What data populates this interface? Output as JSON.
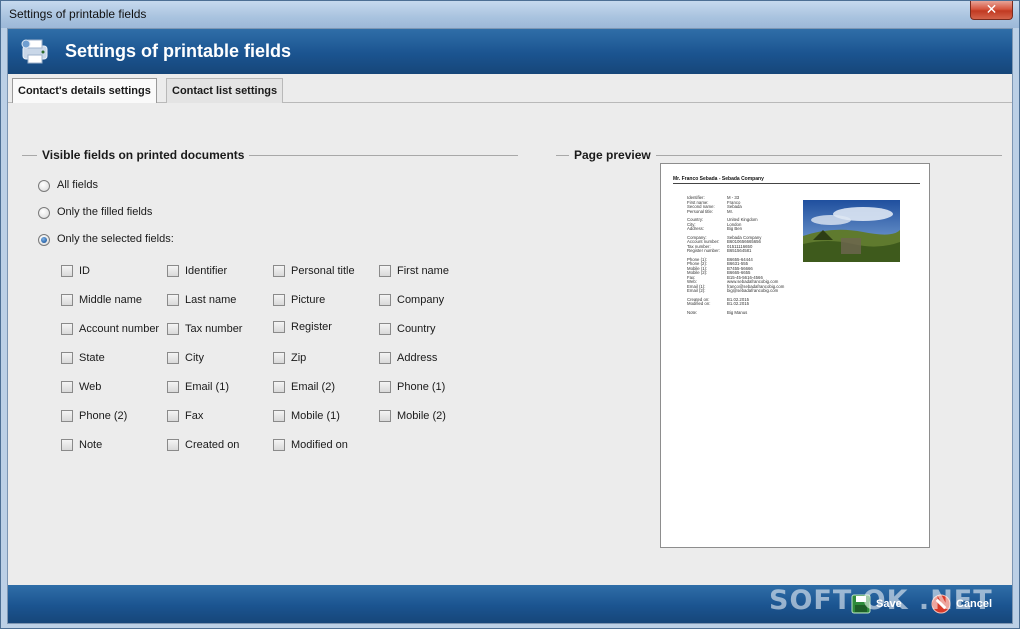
{
  "window": {
    "title": "Settings of printable fields"
  },
  "header": {
    "title": "Settings of printable fields",
    "icon": "settings-printer-icon"
  },
  "tabs": [
    {
      "label": "Contact's details settings",
      "active": true
    },
    {
      "label": "Contact list settings",
      "active": false
    }
  ],
  "visible_fields": {
    "title": "Visible fields on printed documents",
    "options": [
      {
        "label": "All fields",
        "checked": false
      },
      {
        "label": "Only the filled fields",
        "checked": false
      },
      {
        "label": "Only the selected fields:",
        "checked": true
      }
    ],
    "fields": [
      [
        "ID",
        "Identifier",
        "Personal title",
        "First name"
      ],
      [
        "Middle name",
        "Last name",
        "Picture",
        "Company"
      ],
      [
        "Account number",
        "Tax number",
        "Register",
        "Country"
      ],
      [
        "State",
        "City",
        "Zip",
        "Address"
      ],
      [
        "Web",
        "Email (1)",
        "Email (2)",
        "Phone (1)"
      ],
      [
        "Phone (2)",
        "Fax",
        "Mobile (1)",
        "Mobile (2)"
      ],
      [
        "Note",
        "Created on",
        "Modified on"
      ]
    ]
  },
  "preview": {
    "title": "Page preview",
    "heading": "Mr. Franco Sebada - Sebada Company",
    "lines": [
      [
        "Identifier:",
        "M - 33"
      ],
      [
        "First name:",
        "Franco"
      ],
      [
        "Second name:",
        "Sebada"
      ],
      [
        "Personal title:",
        "Mr."
      ],
      [
        "",
        ""
      ],
      [
        "Country:",
        "United Kingdom"
      ],
      [
        "City:",
        "London"
      ],
      [
        "Address:",
        "Big Ben"
      ],
      [
        "",
        ""
      ],
      [
        "Company:",
        "Sebada Company"
      ],
      [
        "Account number:",
        "B6010656665656"
      ],
      [
        "Tax number:",
        "01511116650"
      ],
      [
        "Register number:",
        "B651564581"
      ],
      [
        "",
        ""
      ],
      [
        "Phone (1):",
        "B6655-64444"
      ],
      [
        "Phone (2):",
        "B6631-555"
      ],
      [
        "Mobile (1):",
        "B7455-56666"
      ],
      [
        "Mobile (2):",
        "B6665-6655"
      ],
      [
        "Fax:",
        "B15-45-5616-4566"
      ],
      [
        "Web:",
        "www.sebadafrancobig.com"
      ],
      [
        "Email (1):",
        "franco@sebadafrancobig.com"
      ],
      [
        "Email (2):",
        "big@sebadafrancobig.com"
      ],
      [
        "",
        ""
      ],
      [
        "Created on:",
        "B1.02.2015"
      ],
      [
        "Modified on:",
        "B1.02.2015"
      ],
      [
        "",
        ""
      ],
      [
        "Note:",
        "Big Manus"
      ]
    ]
  },
  "footer": {
    "save_label": "Save",
    "cancel_label": "Cancel"
  },
  "watermark": "SOFT OK .NET"
}
